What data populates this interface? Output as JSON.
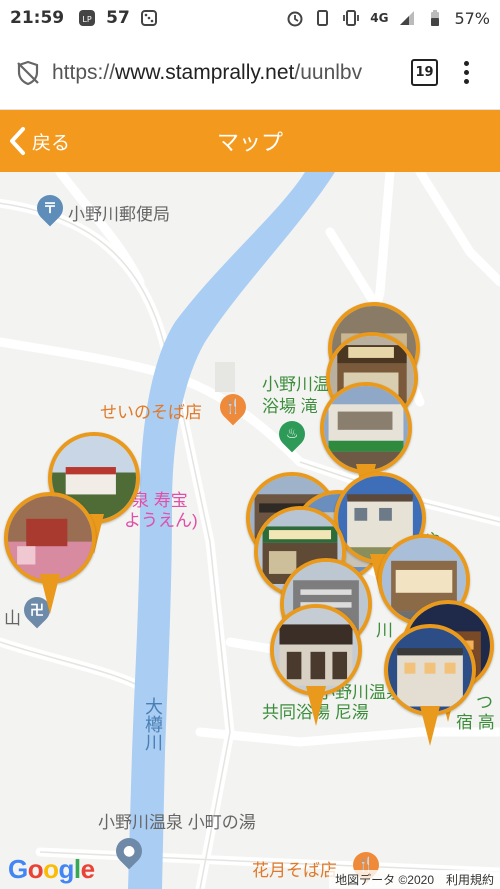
{
  "status_bar": {
    "time": "21:59",
    "notification_count": "57",
    "network": "4G",
    "battery": "57%",
    "icons": [
      "line-icon",
      "dice-icon",
      "alarm-icon",
      "vibrate-icon",
      "signal-icon",
      "battery-icon"
    ]
  },
  "browser": {
    "url_scheme": "https://",
    "url_host": "www.stamprally.net",
    "url_path": "/uunlbv",
    "tab_count": "19"
  },
  "header": {
    "back_label": "戻る",
    "title": "マップ",
    "color": "#f39a1e"
  },
  "map": {
    "labels": {
      "post_office": "小野川郵便局",
      "soba": "せいのそば店",
      "onsen_top_1": "小野川温",
      "onsen_top_2": "浴場 滝",
      "jukuho_1": "泉 寿宝",
      "jukuho_2": "ようえん)",
      "yama": "山",
      "river": "大樽川",
      "kyodo_1": "小野川温泉",
      "kyodo_2": "共同浴場 尼湯",
      "komachi": "小野川温泉 小町の湯",
      "kagetsu": "花月そば店",
      "right_1": "つ",
      "right_2": "宿 高",
      "right_3": "川",
      "right_4": "や"
    },
    "attribution": "地図データ ©2020　利用規約",
    "google_logo": "Google",
    "pin_color": "#e99a1c"
  }
}
